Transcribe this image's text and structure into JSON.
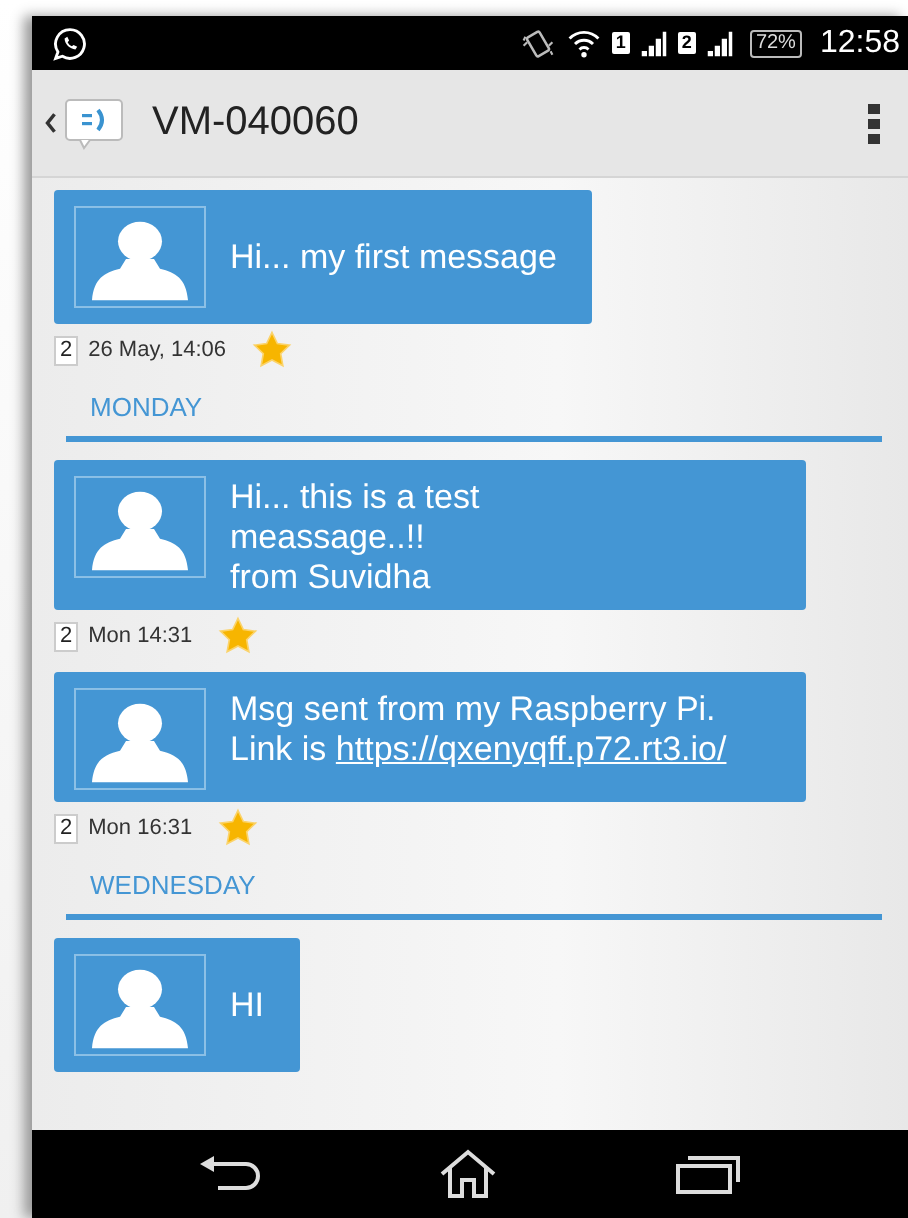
{
  "status_bar": {
    "sims": [
      {
        "label": "1"
      },
      {
        "label": "2"
      }
    ],
    "battery": "72%",
    "time": "12:58"
  },
  "header": {
    "title": "VM-040060"
  },
  "thread": [
    {
      "kind": "message",
      "text": "Hi... my first message",
      "sim": "2",
      "time": "26 May, 14:06",
      "starred": true
    },
    {
      "kind": "day",
      "label": "MONDAY"
    },
    {
      "kind": "message",
      "text": "Hi... this is a test\nmeassage..!!\nfrom Suvidha",
      "sim": "2",
      "time": "Mon 14:31",
      "starred": true
    },
    {
      "kind": "message",
      "text": "Msg sent from my Raspberry Pi. Link is",
      "link": "https://qxenyqff.p72.rt3.io/",
      "sim": "2",
      "time": "Mon 16:31",
      "starred": true
    },
    {
      "kind": "day",
      "label": "WEDNESDAY"
    },
    {
      "kind": "message",
      "text": "HI"
    }
  ]
}
